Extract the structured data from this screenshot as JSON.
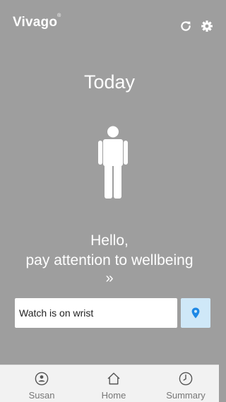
{
  "header": {
    "brand": "Vivago",
    "brand_mark": "®",
    "icons": [
      "refresh-icon",
      "gear-icon"
    ]
  },
  "main": {
    "title": "Today",
    "illustration": "person-figure",
    "greeting_line1": "Hello,",
    "greeting_line2": "pay attention to wellbeing",
    "more_glyph": "»",
    "status_text": "Watch is on wrist",
    "location_icon": "location-pin-icon"
  },
  "nav": {
    "items": [
      {
        "label": "Susan",
        "icon": "user-circle-icon"
      },
      {
        "label": "Home",
        "icon": "home-icon"
      },
      {
        "label": "Summary",
        "icon": "clock-icon"
      }
    ]
  },
  "colors": {
    "background": "#9e9e9e",
    "nav_background": "#f2f2f2",
    "accent_blue": "#1e88e5",
    "location_button_bg": "#cfe8f8"
  }
}
